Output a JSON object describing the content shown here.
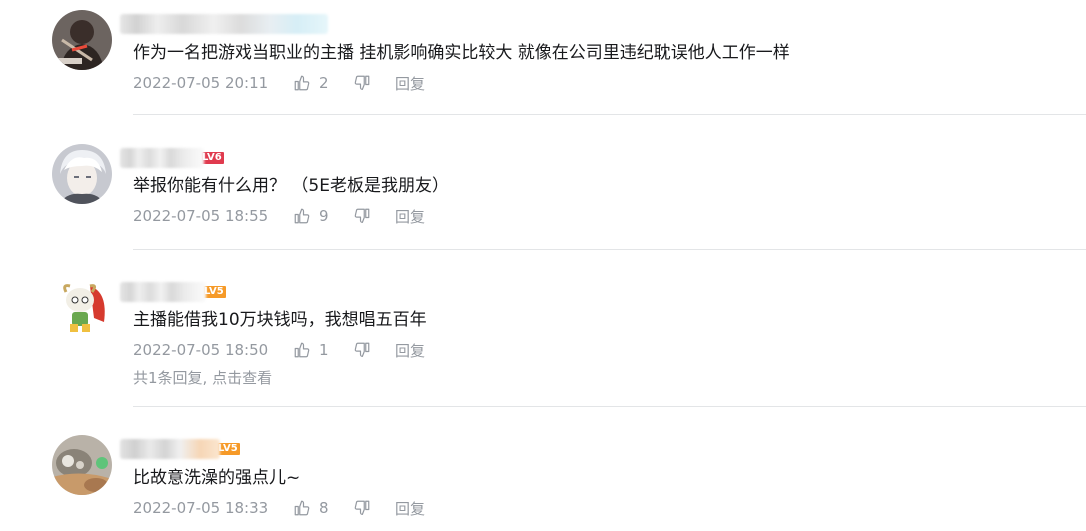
{
  "comments": [
    {
      "badge": "",
      "badge_color": "#ffffff",
      "avatar": "dark-warrior-avatar",
      "text": "作为一名把游戏当职业的主播 挂机影响确实比较大 就像在公司里违纪耽误他人工作一样",
      "time": "2022-07-05 20:11",
      "likes": "2",
      "reply_label": "回复"
    },
    {
      "badge": "LV6",
      "badge_color": "#e03a4e",
      "avatar": "white-hair-anime-avatar",
      "text": "举报你能有什么用？ （5E老板是我朋友）",
      "time": "2022-07-05 18:55",
      "likes": "9",
      "reply_label": "回复"
    },
    {
      "badge": "LV5",
      "badge_color": "#f69a28",
      "avatar": "goat-hero-avatar",
      "text": "主播能借我10万块钱吗，我想唱五百年",
      "time": "2022-07-05 18:50",
      "likes": "1",
      "reply_label": "回复",
      "sub_replies": "共1条回复, 点击查看"
    },
    {
      "badge": "LV5",
      "badge_color": "#f69a28",
      "avatar": "pet-photo-avatar",
      "text": "比故意洗澡的强点儿~",
      "time": "2022-07-05 18:33",
      "likes": "8",
      "reply_label": "回复"
    }
  ],
  "colors": {
    "text": "#18191c",
    "meta": "#9499a0",
    "divider": "#e3e5e7"
  }
}
